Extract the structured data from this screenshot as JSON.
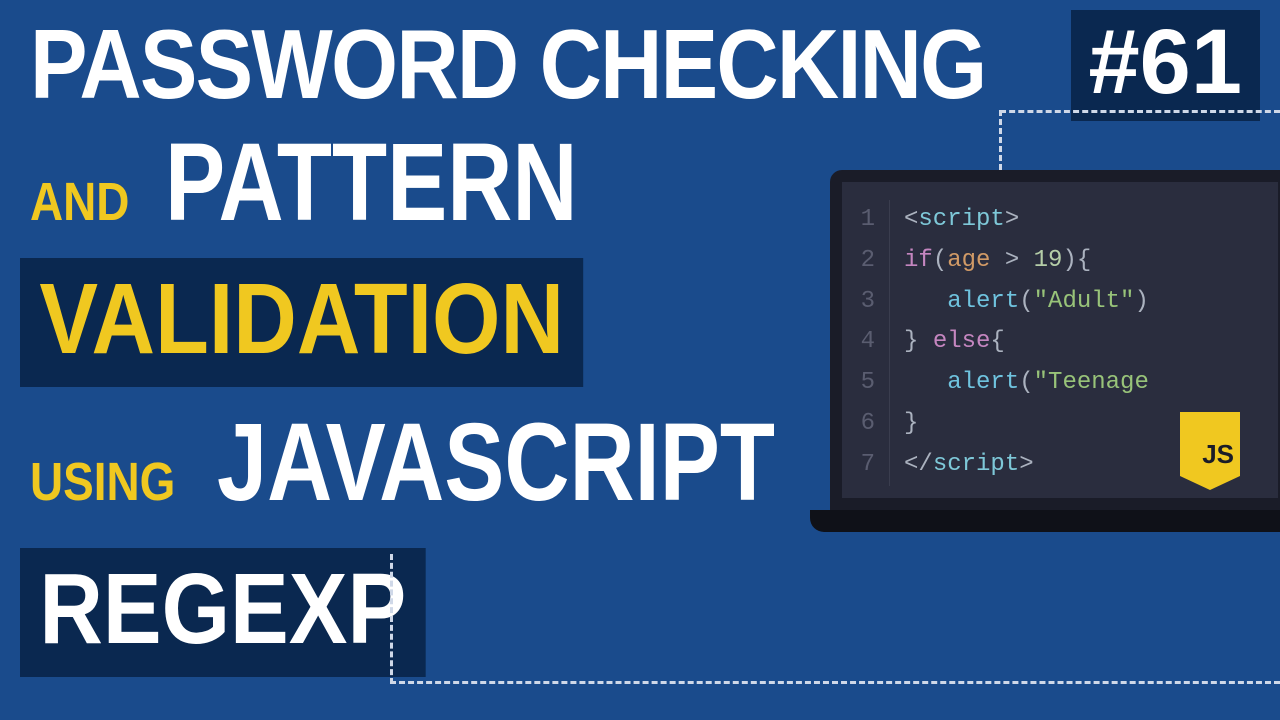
{
  "title": {
    "main": "PASSWORD CHECKING",
    "and": "AND",
    "pattern": "PATTERN",
    "validation": "VALIDATION",
    "using": "USING",
    "javascript": "JAVASCRIPT",
    "regexp": "REGEXP"
  },
  "episode": "#61",
  "js_badge": "JS",
  "code": {
    "lines": [
      {
        "n": "1",
        "html": "<span class='tok-punc'>&lt;</span><span class='tok-tag'>script</span><span class='tok-punc'>&gt;</span>"
      },
      {
        "n": "2",
        "html": "<span class='tok-kw'>if</span><span class='tok-punc'>(</span><span class='tok-var'>age</span> <span class='tok-punc'>&gt;</span> <span class='tok-num'>19</span><span class='tok-punc'>){</span>"
      },
      {
        "n": "3",
        "html": "&nbsp;&nbsp;&nbsp;<span class='tok-fn'>alert</span><span class='tok-punc'>(</span><span class='tok-str'>\"Adult\"</span><span class='tok-punc'>)</span>"
      },
      {
        "n": "4",
        "html": "<span class='tok-punc'>}</span> <span class='tok-kw'>else</span><span class='tok-punc'>{</span>"
      },
      {
        "n": "5",
        "html": "&nbsp;&nbsp;&nbsp;<span class='tok-fn'>alert</span><span class='tok-punc'>(</span><span class='tok-str'>\"Teenage</span>"
      },
      {
        "n": "6",
        "html": "<span class='tok-punc'>}</span>"
      },
      {
        "n": "7",
        "html": "<span class='tok-punc'>&lt;/</span><span class='tok-tag'>script</span><span class='tok-punc'>&gt;</span>"
      }
    ]
  }
}
